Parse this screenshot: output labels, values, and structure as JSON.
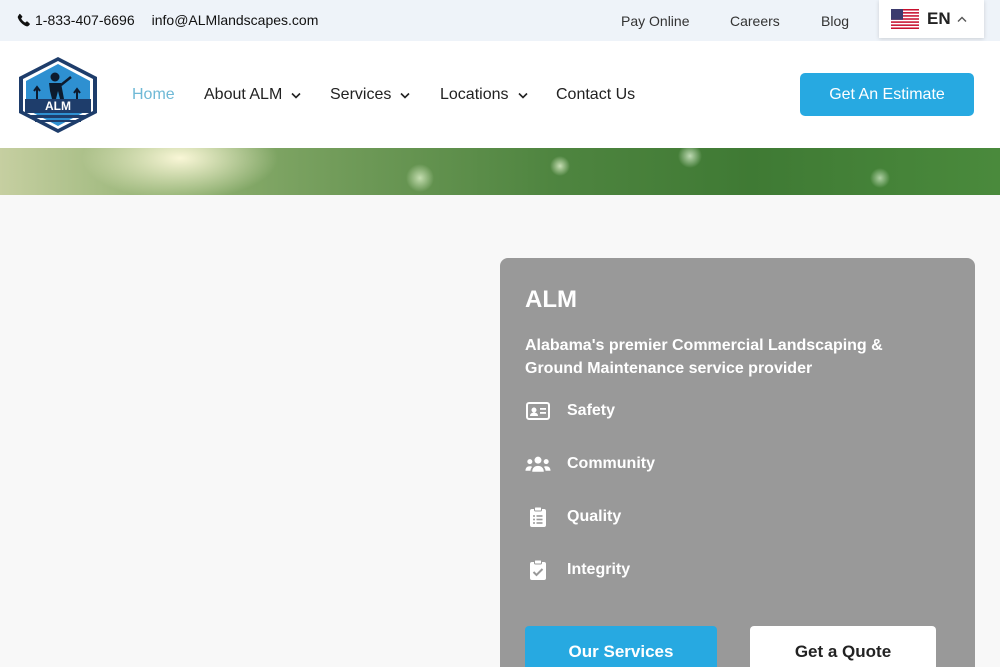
{
  "topbar": {
    "phone": "1-833-407-6696",
    "email": "info@ALMlandscapes.com",
    "links": [
      "Pay Online",
      "Careers",
      "Blog"
    ],
    "language": "EN"
  },
  "header": {
    "logo_text": "ALM",
    "nav": [
      {
        "label": "Home",
        "active": true,
        "dropdown": false
      },
      {
        "label": "About ALM",
        "active": false,
        "dropdown": true
      },
      {
        "label": "Services",
        "active": false,
        "dropdown": true
      },
      {
        "label": "Locations",
        "active": false,
        "dropdown": true
      },
      {
        "label": "Contact Us",
        "active": false,
        "dropdown": false
      }
    ],
    "cta": "Get An Estimate"
  },
  "card": {
    "title": "ALM",
    "subtitle": "Alabama's premier Commercial Landscaping & Ground Maintenance service provider",
    "features": [
      {
        "label": "Safety",
        "icon": "id-card-icon"
      },
      {
        "label": "Community",
        "icon": "users-icon"
      },
      {
        "label": "Quality",
        "icon": "clipboard-list-icon"
      },
      {
        "label": "Integrity",
        "icon": "clipboard-check-icon"
      }
    ],
    "primary_button": "Our Services",
    "secondary_button": "Get a Quote"
  },
  "colors": {
    "accent": "#27a9e1",
    "nav_active": "#6fb9d6",
    "card_bg": "#999999",
    "topbar_bg": "#eef3f9"
  }
}
